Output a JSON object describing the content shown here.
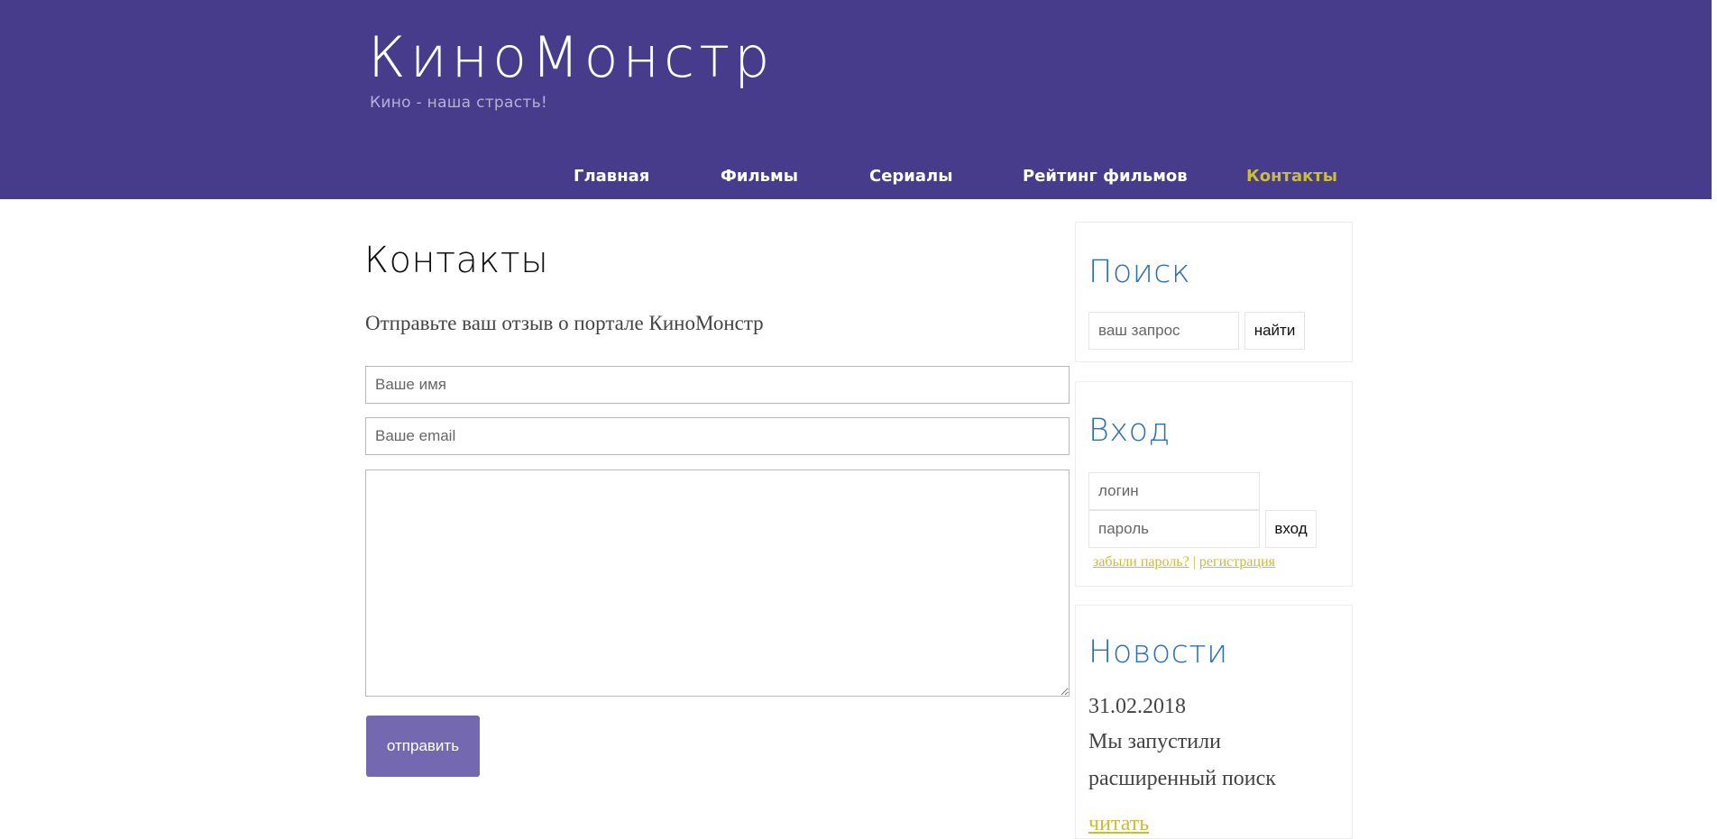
{
  "header": {
    "logo": "КиноМонстр",
    "tagline": "Кино - наша страсть!",
    "nav": [
      {
        "label": "Главная"
      },
      {
        "label": "Фильмы"
      },
      {
        "label": "Сериалы"
      },
      {
        "label": "Рейтинг фильмов"
      },
      {
        "label": "Контакты",
        "active": true
      }
    ]
  },
  "main": {
    "title": "Контакты",
    "subtitle": "Отправьте ваш отзыв о портале КиноМонстр",
    "form": {
      "name_placeholder": "Ваше имя",
      "email_placeholder": "Ваше email",
      "message_value": "",
      "submit_label": "отправить"
    }
  },
  "sidebar": {
    "search": {
      "title": "Поиск",
      "placeholder": "ваш запрос",
      "button": "найти"
    },
    "login": {
      "title": "Вход",
      "login_placeholder": "логин",
      "password_placeholder": "пароль",
      "button": "вход",
      "forgot_link": "забыли пароль?",
      "separator": " | ",
      "register_link": "регистрация"
    },
    "news": {
      "title": "Новости",
      "date": "31.02.2018",
      "text": "Мы запустили расширенный поиск",
      "more_link": "читать"
    }
  },
  "colors": {
    "header_bg": "#473b8b",
    "accent": "#c9bd3a",
    "widget_title": "#2f6fb6",
    "button_bg": "#7468b1"
  }
}
